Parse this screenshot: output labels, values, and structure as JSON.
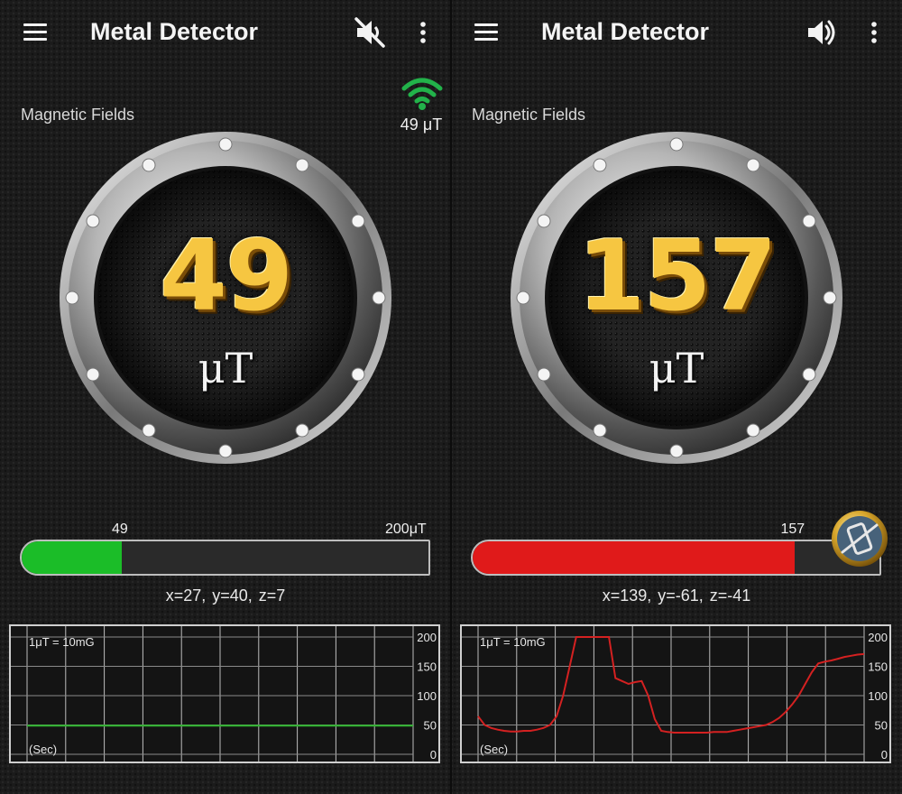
{
  "panels": [
    {
      "title": "Metal Detector",
      "sound_icon": "volume-mute-icon",
      "section_label": "Magnetic Fields",
      "signal": {
        "icon": "wifi-signal-icon",
        "value": "49 μT",
        "color": "#22b24a"
      },
      "reading": "49",
      "unit": "μT",
      "bar": {
        "value_label": "49",
        "max_label": "200μT",
        "fraction": 0.245,
        "color": "#1bbd28"
      },
      "xyz": "x=27,  y=40,  z=7",
      "chart": {
        "label_text": "1μT = 10mG",
        "x_label": "(Sec)",
        "y_ticks": [
          "200",
          "150",
          "100",
          "50",
          "0"
        ],
        "ylim": [
          0,
          200
        ],
        "line_color": "#2fb52f",
        "values": [
          49,
          49,
          49,
          49,
          49,
          49,
          49,
          49,
          49,
          49,
          49,
          49,
          49,
          49,
          49,
          49,
          49,
          49,
          49,
          49,
          49,
          49,
          49,
          49,
          49,
          49,
          49,
          49,
          49,
          49,
          49,
          49,
          49,
          49,
          49,
          49,
          49,
          49,
          49,
          49,
          49,
          49,
          49,
          49,
          49,
          49,
          49,
          49,
          49,
          49,
          49,
          49,
          49,
          49,
          49,
          49,
          49,
          49,
          49,
          49
        ]
      }
    },
    {
      "title": "Metal Detector",
      "sound_icon": "volume-on-icon",
      "section_label": "Magnetic Fields",
      "reading": "157",
      "unit": "μT",
      "bar": {
        "value_label": "157",
        "fraction": 0.785,
        "color": "#e01a1a"
      },
      "xyz": "x=139,  y=-61,  z=-41",
      "calibrate_icon": "calibrate-icon",
      "chart": {
        "label_text": "1μT = 10mG",
        "x_label": "(Sec)",
        "y_ticks": [
          "200",
          "150",
          "100",
          "50",
          "0"
        ],
        "ylim": [
          0,
          200
        ],
        "line_color": "#d42121",
        "values": [
          65,
          50,
          45,
          42,
          40,
          39,
          39,
          40,
          40,
          42,
          45,
          50,
          65,
          100,
          150,
          200,
          200,
          200,
          200,
          200,
          200,
          130,
          125,
          120,
          123,
          125,
          100,
          60,
          40,
          38,
          37,
          37,
          37,
          37,
          37,
          37,
          38,
          38,
          38,
          40,
          42,
          44,
          46,
          48,
          50,
          55,
          62,
          72,
          85,
          100,
          120,
          140,
          155,
          158,
          160,
          163,
          166,
          168,
          170,
          171
        ]
      }
    }
  ]
}
